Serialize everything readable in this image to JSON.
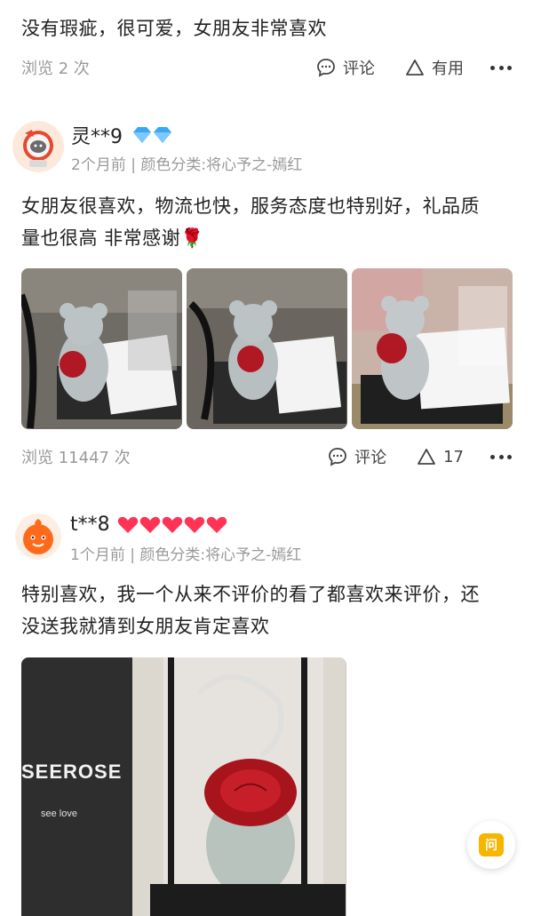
{
  "review0": {
    "text": "没有瑕疵，很可爱，女朋友非常喜欢",
    "views": "浏览 2 次",
    "comment_label": "评论",
    "useful_label": "有用"
  },
  "review1": {
    "username": "灵**9",
    "meta": "2个月前 | 颜色分类:将心予之-嫣红",
    "text_line1": "女朋友很喜欢，物流也快，服务态度也特别好，礼品质",
    "text_line2": "量也很高 非常感谢🌹",
    "views": "浏览 11447 次",
    "comment_label": "评论",
    "useful_count": "17"
  },
  "review2": {
    "username": "t**8",
    "meta": "1个月前 | 颜色分类:将心予之-嫣红",
    "text_line1": "特别喜欢，我一个从来不评价的看了都喜欢来评价，还",
    "text_line2": "没送我就猜到女朋友肯定喜欢",
    "photo_brand": "SEEROSE",
    "photo_sub": "see love"
  },
  "float_button": {
    "label": "问"
  },
  "colors": {
    "diamond": "#38a8f2",
    "heart": "#ff3355",
    "accent": "#f7b500",
    "muted": "#9a9a9a"
  }
}
